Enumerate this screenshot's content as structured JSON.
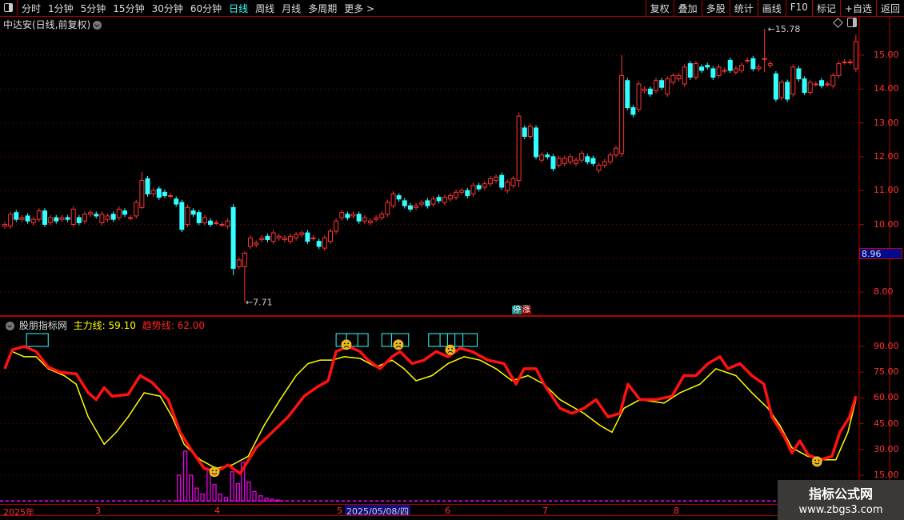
{
  "toolbar": {
    "periods": [
      "分时",
      "1分钟",
      "5分钟",
      "15分钟",
      "30分钟",
      "60分钟",
      "日线",
      "周线",
      "月线",
      "多周期",
      "更多 >"
    ],
    "active_period": "日线",
    "buttons": [
      "复权",
      "叠加",
      "多股",
      "统计",
      "画线",
      "F10",
      "标记",
      "+自选",
      "返回"
    ]
  },
  "stock": {
    "title": "中达安(日线,前复权)"
  },
  "price_axis": {
    "ticks": [
      "15.00",
      "14.00",
      "13.00",
      "12.00",
      "11.00",
      "10.00",
      "8.00"
    ],
    "current_price": "8.96",
    "high_label": "15.78",
    "low_label": "7.71"
  },
  "marker": {
    "a": "停",
    "b": "涨"
  },
  "indicator": {
    "name": "股朋指标网",
    "main_label": "主力线:",
    "main_value": "59.10",
    "trend_label": "趋势线:",
    "trend_value": "62.00",
    "ticks": [
      "90.00",
      "75.00",
      "60.00",
      "45.00",
      "30.00",
      "15.00"
    ]
  },
  "date_axis": {
    "labels": [
      "2025年",
      "3",
      "4",
      "5",
      "6",
      "7",
      "8"
    ],
    "selected": "2025/05/08/四"
  },
  "watermark": {
    "line1": "指标公式网",
    "line2": "www.zbgs3.com"
  },
  "colors": {
    "up": "#ff3333",
    "down": "#33ffff",
    "main_line": "#ffff00",
    "trend_line": "#ff1111",
    "bars": "#ff00ff"
  },
  "chart_data": {
    "type": "candlestick",
    "price_range": [
      7.5,
      16.2
    ],
    "wick": 0.08,
    "candles": [
      [
        9.95,
        10.0
      ],
      [
        9.95,
        10.3
      ],
      [
        10.35,
        10.15
      ],
      [
        10.15,
        10.2
      ],
      [
        10.25,
        10.1
      ],
      [
        10.05,
        10.15
      ],
      [
        10.15,
        10.4
      ],
      [
        10.4,
        10.0
      ],
      [
        10.05,
        10.2
      ],
      [
        10.2,
        10.1
      ],
      [
        10.15,
        10.2
      ],
      [
        10.2,
        10.15
      ],
      [
        10.0,
        10.45
      ],
      [
        10.2,
        10.05
      ],
      [
        10.1,
        10.3
      ],
      [
        10.3,
        10.35
      ],
      [
        10.3,
        10.25
      ],
      [
        10.05,
        10.3
      ],
      [
        10.15,
        10.25
      ],
      [
        10.3,
        10.15
      ],
      [
        10.2,
        10.45
      ],
      [
        10.4,
        10.3
      ],
      [
        10.2,
        10.2
      ],
      [
        10.25,
        10.65
      ],
      [
        10.5,
        11.3
      ],
      [
        11.35,
        10.9
      ],
      [
        10.9,
        11.0
      ],
      [
        11.05,
        10.8
      ],
      [
        10.95,
        10.85
      ],
      [
        10.85,
        10.85
      ],
      [
        10.75,
        10.6
      ],
      [
        10.65,
        9.85
      ],
      [
        10.0,
        10.5
      ],
      [
        10.4,
        10.3
      ],
      [
        10.35,
        10.05
      ],
      [
        10.05,
        10.2
      ],
      [
        10.1,
        10.0
      ],
      [
        10.05,
        10.05
      ],
      [
        10.0,
        10.0
      ],
      [
        9.95,
        10.1
      ],
      [
        10.5,
        8.7
      ],
      [
        8.75,
        8.95
      ],
      [
        8.75,
        9.15
      ],
      [
        9.35,
        9.6
      ],
      [
        9.4,
        9.45
      ],
      [
        9.55,
        9.6
      ],
      [
        9.65,
        9.55
      ],
      [
        9.5,
        9.75
      ],
      [
        9.6,
        9.65
      ],
      [
        9.55,
        9.6
      ],
      [
        9.5,
        9.65
      ],
      [
        9.6,
        9.7
      ],
      [
        9.7,
        9.75
      ],
      [
        9.75,
        9.5
      ],
      [
        9.6,
        9.6
      ],
      [
        9.5,
        9.35
      ],
      [
        9.3,
        9.6
      ],
      [
        9.5,
        9.8
      ],
      [
        9.8,
        10.1
      ],
      [
        10.2,
        10.35
      ],
      [
        10.3,
        10.2
      ],
      [
        10.25,
        10.3
      ],
      [
        10.3,
        10.1
      ],
      [
        10.1,
        10.2
      ],
      [
        10.05,
        10.1
      ],
      [
        10.15,
        10.2
      ],
      [
        10.2,
        10.3
      ],
      [
        10.3,
        10.65
      ],
      [
        10.55,
        10.9
      ],
      [
        10.85,
        10.75
      ],
      [
        10.7,
        10.55
      ],
      [
        10.55,
        10.45
      ],
      [
        10.5,
        10.55
      ],
      [
        10.6,
        10.65
      ],
      [
        10.7,
        10.55
      ],
      [
        10.6,
        10.75
      ],
      [
        10.8,
        10.7
      ],
      [
        10.65,
        10.8
      ],
      [
        10.75,
        10.85
      ],
      [
        10.8,
        10.95
      ],
      [
        10.95,
        11.0
      ],
      [
        11.0,
        10.85
      ],
      [
        10.9,
        11.15
      ],
      [
        11.15,
        11.05
      ],
      [
        11.1,
        11.2
      ],
      [
        11.2,
        11.35
      ],
      [
        11.3,
        11.4
      ],
      [
        11.45,
        11.1
      ],
      [
        11.0,
        11.25
      ],
      [
        11.15,
        11.35
      ],
      [
        11.3,
        13.2
      ],
      [
        12.85,
        12.6
      ],
      [
        12.6,
        12.9
      ],
      [
        12.85,
        12.0
      ],
      [
        11.9,
        12.05
      ],
      [
        12.05,
        12.0
      ],
      [
        12.0,
        11.65
      ],
      [
        11.75,
        11.95
      ],
      [
        11.8,
        11.95
      ],
      [
        11.85,
        12.0
      ],
      [
        11.8,
        11.9
      ],
      [
        11.9,
        12.1
      ],
      [
        12.0,
        11.85
      ],
      [
        11.95,
        11.8
      ],
      [
        11.6,
        11.75
      ],
      [
        11.75,
        11.85
      ],
      [
        11.85,
        12.05
      ],
      [
        12.05,
        12.25
      ],
      [
        12.1,
        14.4
      ],
      [
        14.25,
        13.45
      ],
      [
        13.45,
        13.25
      ],
      [
        13.4,
        14.15
      ],
      [
        13.95,
        14.0
      ],
      [
        14.0,
        13.85
      ],
      [
        13.95,
        14.25
      ],
      [
        14.25,
        14.05
      ],
      [
        13.85,
        14.3
      ],
      [
        14.2,
        14.4
      ],
      [
        14.3,
        14.4
      ],
      [
        14.15,
        14.65
      ],
      [
        14.75,
        14.35
      ],
      [
        14.35,
        14.75
      ],
      [
        14.65,
        14.55
      ],
      [
        14.7,
        14.65
      ],
      [
        14.6,
        14.35
      ],
      [
        14.4,
        14.65
      ],
      [
        14.55,
        14.55
      ],
      [
        14.85,
        14.55
      ],
      [
        14.5,
        14.6
      ],
      [
        14.55,
        14.7
      ],
      [
        14.85,
        14.85
      ],
      [
        14.9,
        14.6
      ],
      [
        14.6,
        14.65
      ],
      [
        14.9,
        14.9
      ],
      [
        14.7,
        14.75
      ],
      [
        14.45,
        13.7
      ],
      [
        13.75,
        14.2
      ],
      [
        14.2,
        13.7
      ],
      [
        13.85,
        14.65
      ],
      [
        14.6,
        14.3
      ],
      [
        14.3,
        13.9
      ],
      [
        13.9,
        14.2
      ],
      [
        14.15,
        14.15
      ],
      [
        14.25,
        14.1
      ],
      [
        14.15,
        14.15
      ],
      [
        14.1,
        14.4
      ],
      [
        14.4,
        14.75
      ],
      [
        14.8,
        14.8
      ],
      [
        14.8,
        14.8
      ],
      [
        14.6,
        15.4
      ]
    ],
    "extremes": {
      "24": [
        11.55,
        10.45
      ],
      "40": [
        10.6,
        8.5
      ],
      "42": [
        9.2,
        7.71
      ],
      "90": [
        13.3,
        11.1
      ],
      "108": [
        15.0,
        12.0
      ],
      "133": [
        15.78,
        14.5
      ],
      "149": [
        15.6,
        14.5
      ]
    },
    "indicator_range": [
      0,
      100
    ],
    "main_line": [
      [
        0,
        77
      ],
      [
        1.3,
        87
      ],
      [
        3.4,
        84
      ],
      [
        5.5,
        84
      ],
      [
        7.6,
        77
      ],
      [
        10.4,
        73
      ],
      [
        12.5,
        68
      ],
      [
        14.6,
        49
      ],
      [
        17.4,
        33
      ],
      [
        19.5,
        40
      ],
      [
        21.6,
        49
      ],
      [
        24.4,
        63
      ],
      [
        27.2,
        61
      ],
      [
        29.3,
        49
      ],
      [
        31.4,
        33
      ],
      [
        34.2,
        24
      ],
      [
        37,
        19
      ],
      [
        39.8,
        21
      ],
      [
        42.6,
        26
      ],
      [
        45.4,
        44
      ],
      [
        48.2,
        59
      ],
      [
        51,
        73
      ],
      [
        53.1,
        80
      ],
      [
        55.2,
        82
      ],
      [
        57.3,
        82
      ],
      [
        59.4,
        84
      ],
      [
        62.2,
        83
      ],
      [
        65,
        78
      ],
      [
        67.8,
        82
      ],
      [
        69.9,
        77
      ],
      [
        72,
        70
      ],
      [
        74.8,
        73
      ],
      [
        77.6,
        80
      ],
      [
        80.4,
        84
      ],
      [
        83.2,
        82
      ],
      [
        86,
        77
      ],
      [
        88.8,
        70
      ],
      [
        91.6,
        73
      ],
      [
        94.4,
        68
      ],
      [
        97.2,
        59
      ],
      [
        101.4,
        51
      ],
      [
        104.2,
        44
      ],
      [
        106.3,
        40
      ],
      [
        108.4,
        54
      ],
      [
        111.2,
        59
      ],
      [
        115.4,
        57
      ],
      [
        118.2,
        63
      ],
      [
        121.7,
        68
      ],
      [
        124.5,
        77
      ],
      [
        128,
        73
      ],
      [
        130.8,
        63
      ],
      [
        133.6,
        54
      ],
      [
        135.7,
        44
      ],
      [
        137.8,
        31
      ],
      [
        140.6,
        26
      ],
      [
        143.4,
        24
      ],
      [
        145.5,
        24
      ],
      [
        147.6,
        40
      ],
      [
        149,
        59
      ]
    ],
    "trend_line": [
      [
        0,
        77
      ],
      [
        1.3,
        88
      ],
      [
        3.4,
        90
      ],
      [
        5.5,
        87
      ],
      [
        7.6,
        78
      ],
      [
        9.7,
        75
      ],
      [
        12.5,
        74
      ],
      [
        14.6,
        63
      ],
      [
        16,
        59
      ],
      [
        17.4,
        66
      ],
      [
        18.8,
        61
      ],
      [
        21.6,
        62
      ],
      [
        23.7,
        73
      ],
      [
        25.8,
        69
      ],
      [
        28.6,
        59
      ],
      [
        30.7,
        40
      ],
      [
        32.8,
        29
      ],
      [
        34.9,
        19
      ],
      [
        37,
        17
      ],
      [
        39.1,
        21
      ],
      [
        41.2,
        16
      ],
      [
        44,
        31
      ],
      [
        46.8,
        40
      ],
      [
        49.6,
        49
      ],
      [
        52.4,
        61
      ],
      [
        54.5,
        66
      ],
      [
        56.6,
        70
      ],
      [
        58,
        87
      ],
      [
        60.1,
        90
      ],
      [
        62.2,
        87
      ],
      [
        63.6,
        82
      ],
      [
        65.7,
        77
      ],
      [
        67.8,
        84
      ],
      [
        69.2,
        87
      ],
      [
        71.3,
        80
      ],
      [
        73.4,
        82
      ],
      [
        75.5,
        87
      ],
      [
        77.6,
        84
      ],
      [
        79.7,
        89
      ],
      [
        81.8,
        87
      ],
      [
        84.6,
        82
      ],
      [
        87.4,
        80
      ],
      [
        89.5,
        68
      ],
      [
        90.9,
        77
      ],
      [
        93,
        77
      ],
      [
        94.4,
        68
      ],
      [
        97.2,
        54
      ],
      [
        99.3,
        51
      ],
      [
        101.4,
        54
      ],
      [
        103.5,
        59
      ],
      [
        105.6,
        49
      ],
      [
        107.7,
        51
      ],
      [
        109.1,
        68
      ],
      [
        111.2,
        59
      ],
      [
        114,
        59
      ],
      [
        116.8,
        61
      ],
      [
        118.9,
        73
      ],
      [
        121,
        73
      ],
      [
        123.1,
        80
      ],
      [
        125.2,
        84
      ],
      [
        126.6,
        77
      ],
      [
        128.7,
        80
      ],
      [
        130.8,
        73
      ],
      [
        132.9,
        68
      ],
      [
        134.3,
        49
      ],
      [
        136.4,
        38
      ],
      [
        137.8,
        28
      ],
      [
        139.2,
        35
      ],
      [
        140.6,
        27
      ],
      [
        142.7,
        24
      ],
      [
        144.8,
        26
      ],
      [
        146.2,
        40
      ],
      [
        147.9,
        49
      ],
      [
        149,
        61
      ]
    ],
    "volume_bars": [
      [
        30.5,
        15
      ],
      [
        31.6,
        29
      ],
      [
        32.6,
        15
      ],
      [
        33.6,
        7.5
      ],
      [
        34.6,
        4
      ],
      [
        35.7,
        18
      ],
      [
        36.7,
        9.5
      ],
      [
        37.7,
        4
      ],
      [
        38.7,
        2
      ],
      [
        39.8,
        17
      ],
      [
        40.8,
        10
      ],
      [
        41.7,
        22.5
      ],
      [
        42.7,
        11
      ],
      [
        43.7,
        5.5
      ],
      [
        44.8,
        3
      ],
      [
        45.8,
        1.5
      ],
      [
        46.8,
        1
      ],
      [
        47.8,
        0.5
      ]
    ],
    "signal_boxes": [
      [
        3.8,
        7.6
      ],
      [
        58,
        63.6
      ],
      [
        66,
        70.7
      ],
      [
        74.2,
        82.7
      ]
    ],
    "box_dividers": [
      59.8,
      61.8,
      67.7,
      76.2,
      77.5,
      78.8,
      80.2
    ],
    "sad_faces": [
      [
        59.8,
        91
      ],
      [
        68.9,
        91
      ],
      [
        78,
        88
      ]
    ],
    "happy_faces": [
      [
        36.7,
        17
      ],
      [
        142.2,
        23
      ]
    ]
  }
}
